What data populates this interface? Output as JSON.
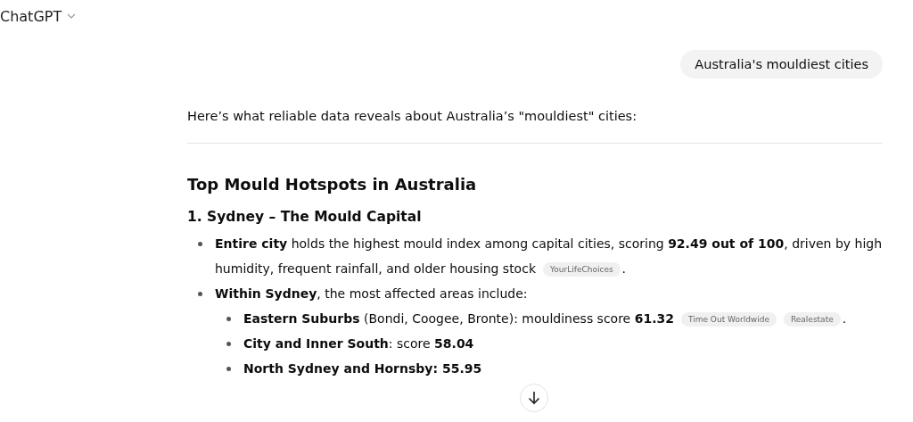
{
  "header": {
    "title": "ChatGPT"
  },
  "user_message": "Australia's mouldiest cities",
  "reply": {
    "intro": "Here’s what reliable data reveals about Australia’s \"mouldiest\" cities:",
    "heading": "Top Mould Hotspots in Australia",
    "subheading": "1. Sydney – The Mould Capital",
    "items": [
      {
        "text": "**Entire city** holds the highest mould index among capital cities, scoring **92.49 out of 100**, driven by high humidity, frequent rainfall, and older housing stock",
        "citations": [
          "YourLifeChoices"
        ],
        "after": "."
      },
      {
        "text": "**Within Sydney**, the most affected areas include:",
        "children": [
          {
            "text": "**Eastern Suburbs** (Bondi, Coogee, Bronte): mouldiness score **61.32**",
            "citations": [
              "Time Out Worldwide",
              "Realestate"
            ],
            "after": "."
          },
          {
            "text": "**City and Inner South**: score **58.04**"
          },
          {
            "text": "**North Sydney and Hornsby: 55.95**"
          }
        ]
      }
    ]
  }
}
